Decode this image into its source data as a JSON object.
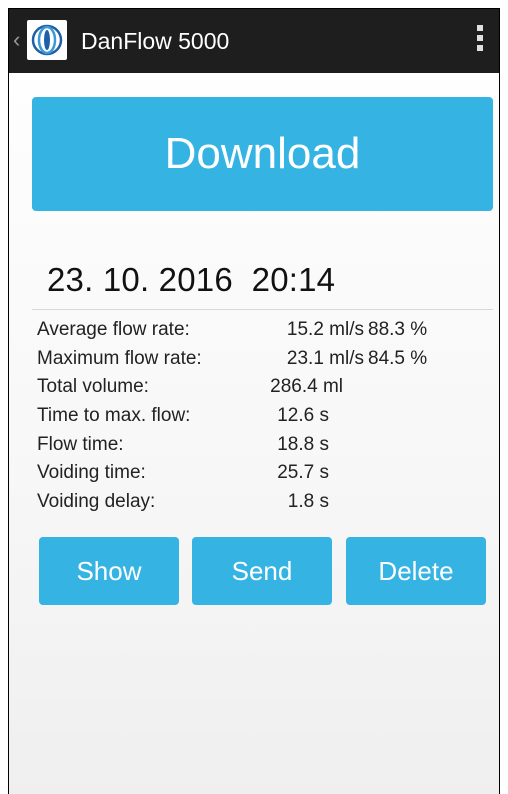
{
  "actionbar": {
    "title": "DanFlow 5000",
    "back_icon": "chevron-left-icon",
    "logo_icon": "danflow-logo-icon",
    "menu_icon": "overflow-menu-icon"
  },
  "download": {
    "label": "Download"
  },
  "measurement": {
    "date": "23. 10. 2016",
    "time": "20:14",
    "stats": [
      {
        "label": "Average flow rate:",
        "value": "15.2 ml/s",
        "percent": "88.3 %"
      },
      {
        "label": "Maximum flow rate:",
        "value": "23.1 ml/s",
        "percent": "84.5 %"
      },
      {
        "label": "Total volume:",
        "value": "286.4 ml"
      },
      {
        "label": "Time to max. flow:",
        "value": "12.6 s"
      },
      {
        "label": "Flow time:",
        "value": "18.8 s"
      },
      {
        "label": "Voiding time:",
        "value": "25.7 s"
      },
      {
        "label": "Voiding delay:",
        "value": "1.8 s"
      }
    ]
  },
  "actions": {
    "show": "Show",
    "send": "Send",
    "delete": "Delete"
  },
  "colors": {
    "accent": "#35b4e4",
    "actionbar": "#1e1e1e"
  }
}
